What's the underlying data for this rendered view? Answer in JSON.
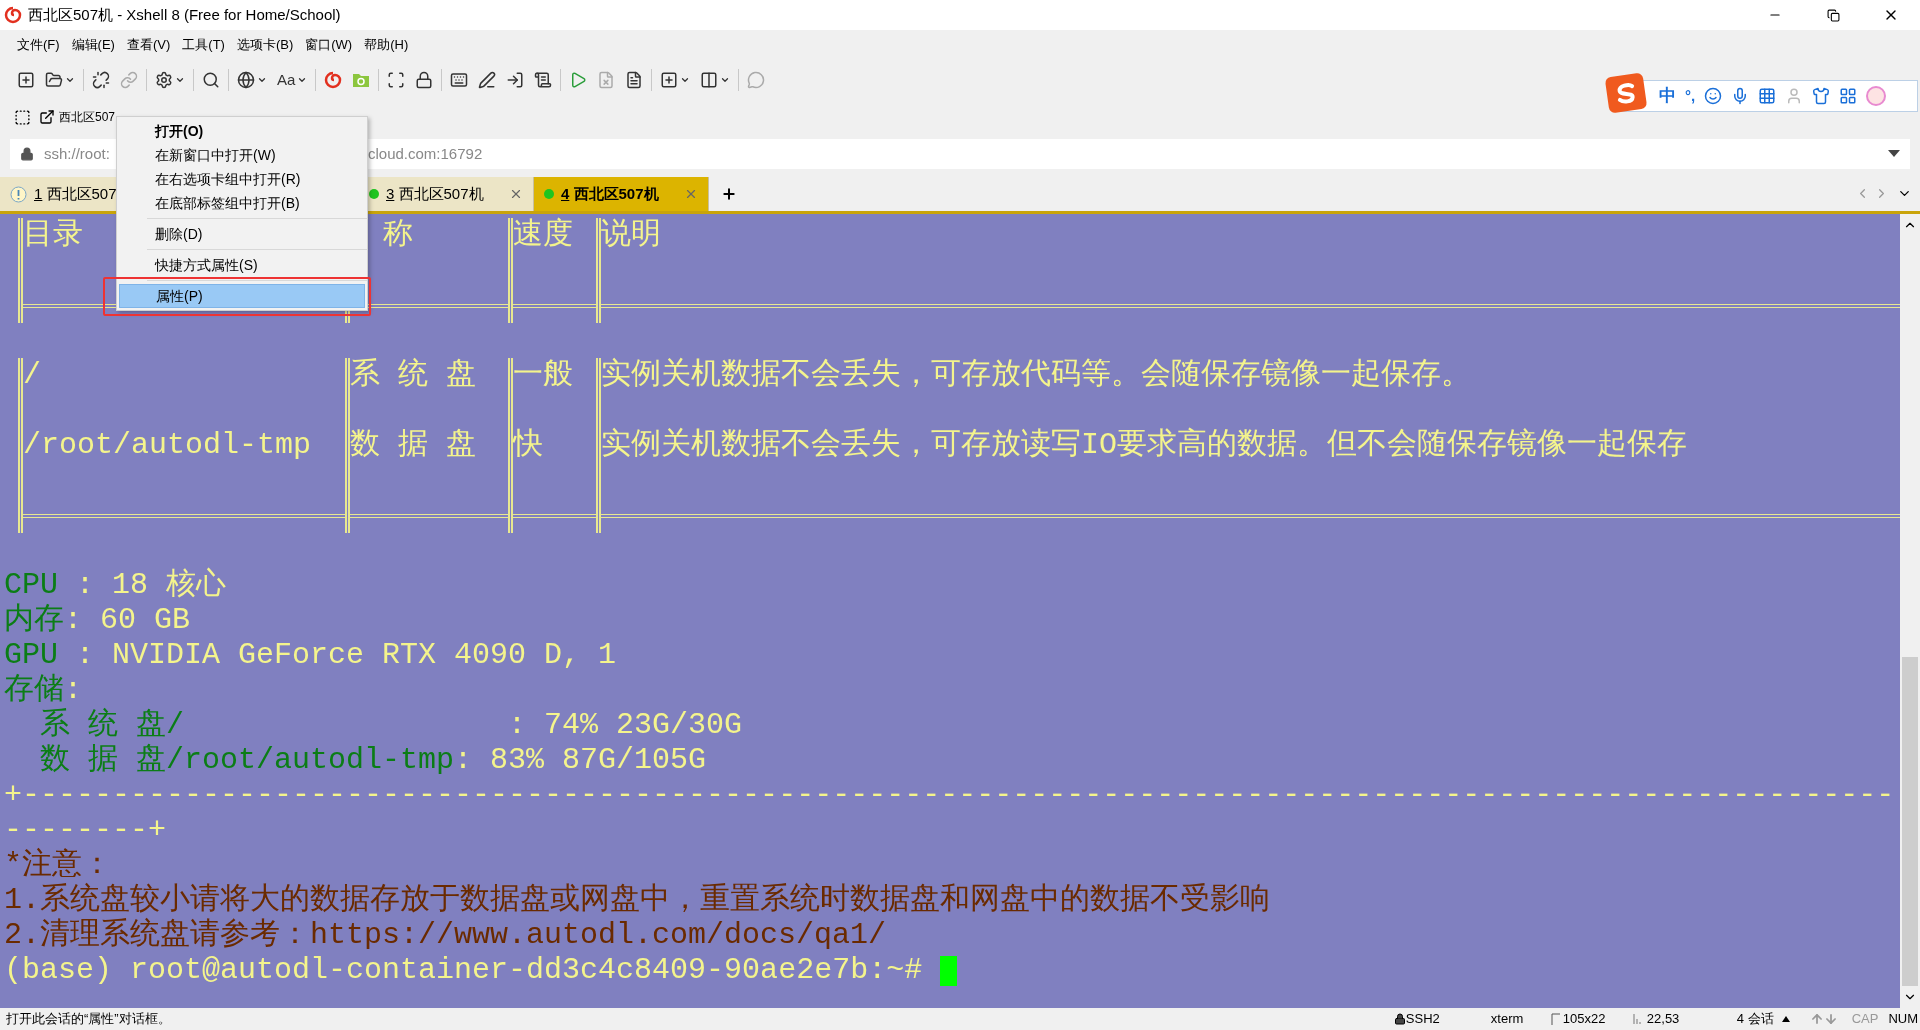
{
  "window": {
    "title": "西北区507机 - Xshell 8 (Free for Home/School)"
  },
  "menu_bar": [
    "文件(F)",
    "编辑(E)",
    "查看(V)",
    "工具(T)",
    "选项卡(B)",
    "窗口(W)",
    "帮助(H)"
  ],
  "toolbar": {
    "font_label": "Aa"
  },
  "ime_bar": {
    "mode": "中",
    "punctuation": "°,"
  },
  "links_bar": {
    "link": "西北区507"
  },
  "address_bar": {
    "before_menu": "ssh://root:",
    "after_menu": "cloud.com:16792"
  },
  "tabs": [
    {
      "number": "1",
      "label": "西北区507",
      "kind": "info",
      "selected": false
    },
    {
      "number": "3",
      "label": "西北区507机",
      "kind": "session",
      "selected": false
    },
    {
      "number": "4",
      "label": "西北区507机",
      "kind": "session",
      "selected": true
    }
  ],
  "context_menu": {
    "items": [
      {
        "kind": "item",
        "label": "打开(O)",
        "default": true,
        "selected": false
      },
      {
        "kind": "item",
        "label": "在新窗口中打开(W)",
        "default": false,
        "selected": false
      },
      {
        "kind": "item",
        "label": "在右选项卡组中打开(R)",
        "default": false,
        "selected": false
      },
      {
        "kind": "item",
        "label": "在底部标签组中打开(B)",
        "default": false,
        "selected": false
      },
      {
        "kind": "separator"
      },
      {
        "kind": "item",
        "label": "删除(D)",
        "default": false,
        "selected": false
      },
      {
        "kind": "separator"
      },
      {
        "kind": "item",
        "label": "快捷方式属性(S)",
        "default": false,
        "selected": false
      },
      {
        "kind": "separator"
      },
      {
        "kind": "item",
        "label": "属性(P)",
        "default": false,
        "selected": true
      }
    ]
  },
  "terminal": {
    "table": {
      "headers": [
        "目录",
        "称",
        "速度",
        "说明"
      ],
      "rows": [
        [
          "/",
          "系 统 盘",
          "一般",
          "实例关机数据不会丢失，可存放代码等。会随保存镜像一起保存。"
        ],
        [
          "/root/autodl-tmp",
          "数 据 盘",
          "快",
          "实例关机数据不会丢失，可存放读写IO要求高的数据。但不会随保存镜像一起保存"
        ]
      ]
    },
    "info": [
      {
        "label": "CPU ",
        "value": ": 18 核心"
      },
      {
        "label": "内存",
        "value": ": 60 GB"
      },
      {
        "label": "GPU ",
        "value": ": NVIDIA GeForce RTX 4090 D, 1"
      },
      {
        "label": "存储",
        "value": ":"
      },
      {
        "label": "  系 统 盘/",
        "value": "                  : 74% 23G/30G"
      },
      {
        "label": "  数 据 盘/root/autodl-tmp",
        "value": ": 83% 87G/105G"
      }
    ],
    "separator": [
      "+--------------------------------------------------------------------------------------------------------",
      "--------+"
    ],
    "notes": [
      "*注意：",
      "1.系统盘较小请将大的数据存放于数据盘或网盘中，重置系统时数据盘和网盘中的数据不受影响",
      "2.清理系统盘请参考：https://www.autodl.com/docs/qa1/"
    ],
    "prompt": "(base) root@autodl-container-dd3c4c8409-90ae2e7b:~# "
  },
  "status_bar": {
    "message": "打开此会话的“属性”对话框。",
    "protocol": "SSH2",
    "terminal_type": "xterm",
    "size": "105x22",
    "cursor": "22,53",
    "sessions": "4 会话",
    "caps": "CAP",
    "caps_on": false,
    "num": "NUM",
    "num_on": true
  }
}
